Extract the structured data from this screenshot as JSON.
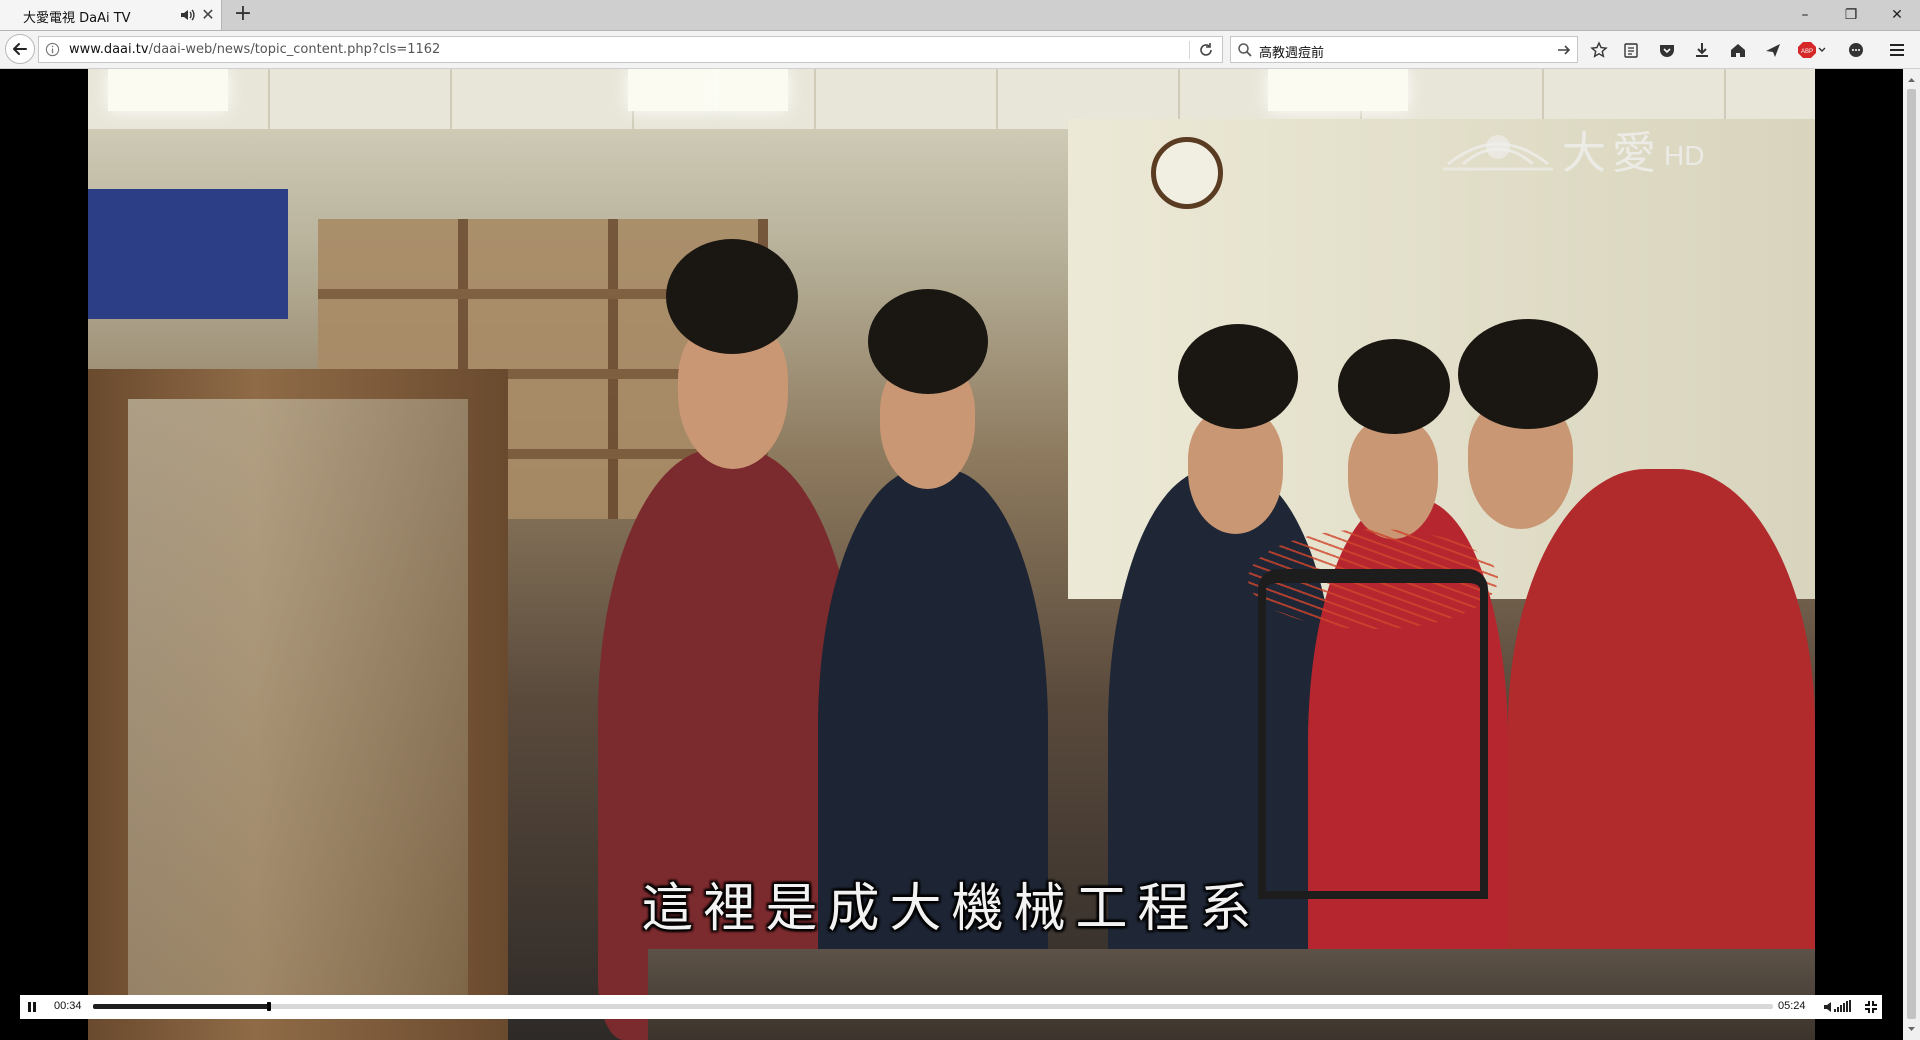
{
  "tab": {
    "title": "大愛電視 DaAi TV",
    "audio_icon": "speaker-icon",
    "close_icon": "close-icon",
    "new_tab_icon": "plus-icon"
  },
  "window": {
    "minimize": "–",
    "restore": "❐",
    "close": "✕"
  },
  "nav": {
    "url_host": "www.daai.tv",
    "url_path": "/daai-web/news/topic_content.php?cls=1162",
    "search_value": "高教週痘前"
  },
  "video": {
    "watermark_text": "大愛",
    "watermark_hd": "HD",
    "subtitle": "這裡是成大機械工程系",
    "current_time": "00:34",
    "total_time": "05:24",
    "progress_fraction": 0.105
  },
  "colors": {
    "video_background": "#000000",
    "controls_background": "#ffffff",
    "progress_fill": "#1e1e1e"
  }
}
